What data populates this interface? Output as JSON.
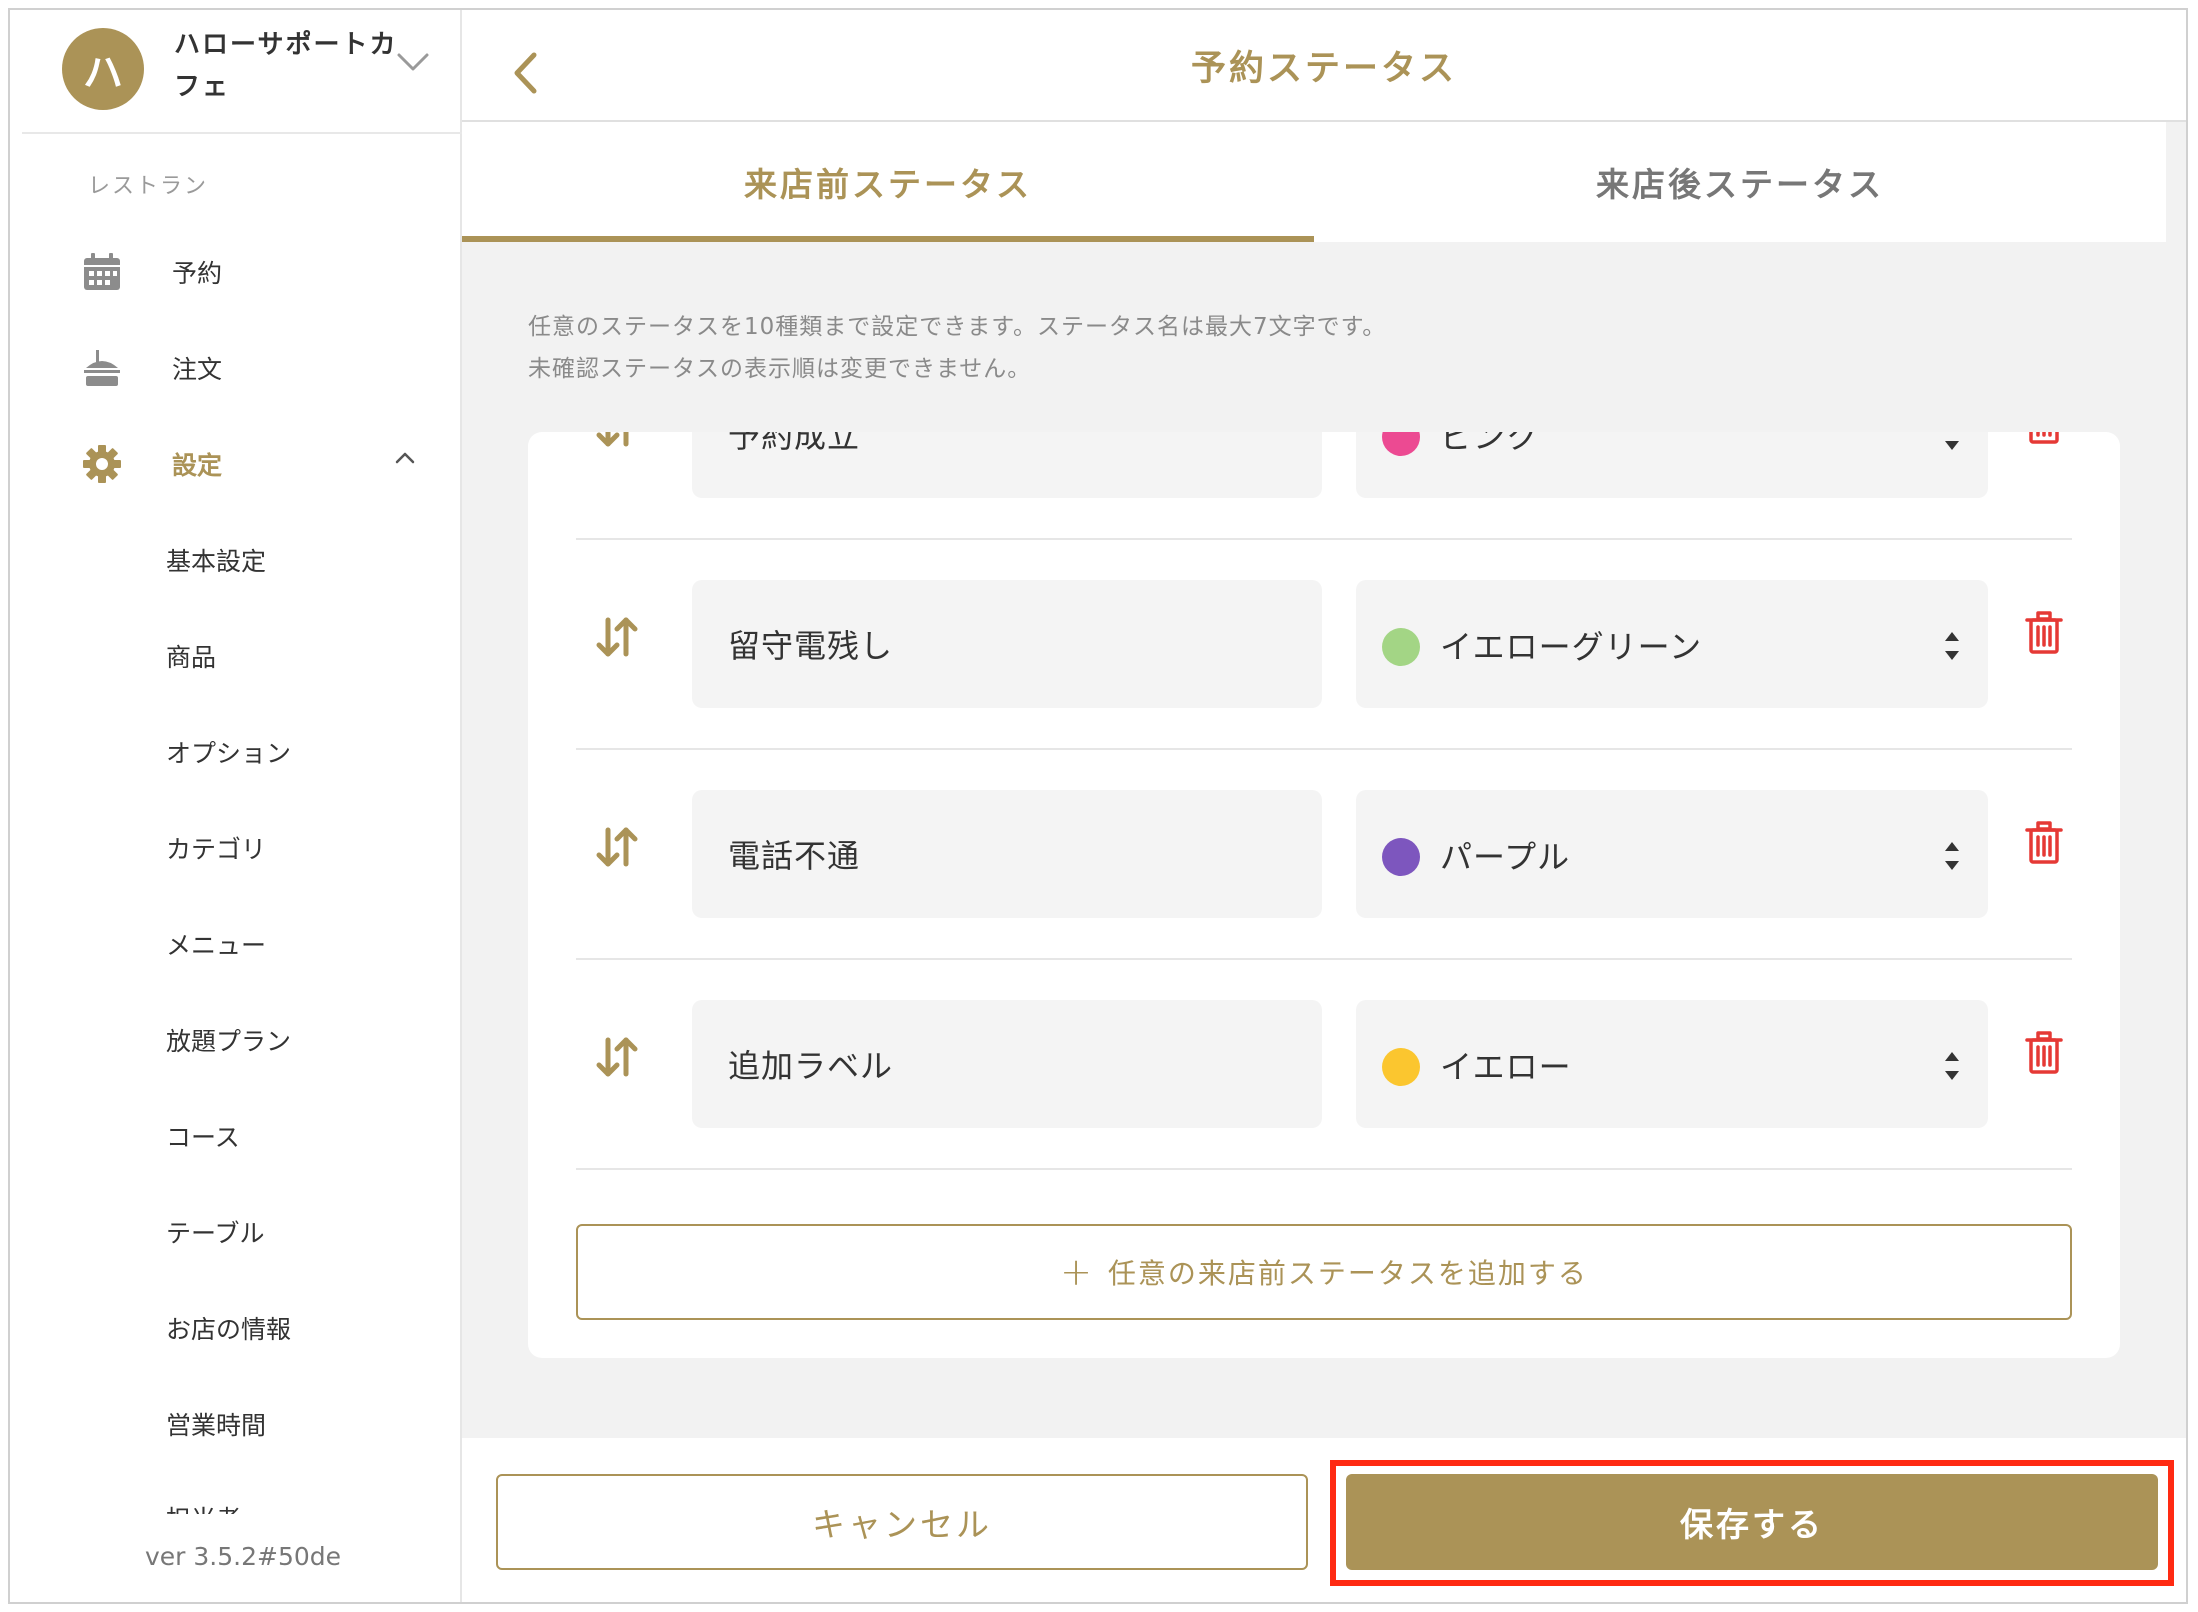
{
  "sidebar": {
    "avatar_initial": "ハ",
    "store_name": "ハローサポートカフェ",
    "section_label": "レストラン",
    "nav": {
      "reservations": "予約",
      "orders": "注文",
      "settings": "設定"
    },
    "settings_items": [
      "基本設定",
      "商品",
      "オプション",
      "カテゴリ",
      "メニュー",
      "放題プラン",
      "コース",
      "テーブル",
      "お店の情報",
      "営業時間"
    ],
    "partial_item": "担当者",
    "version": "ver 3.5.2#50de"
  },
  "header": {
    "title": "予約ステータス"
  },
  "tabs": {
    "before_visit": "来店前ステータス",
    "after_visit": "来店後ステータス"
  },
  "description": {
    "line1": "任意のステータスを10種類まで設定できます。ステータス名は最大7文字です。",
    "line2": "未確認ステータスの表示順は変更できません。"
  },
  "statuses": [
    {
      "name": "予約成立",
      "color_label": "ピンク",
      "color": "#ec4a92"
    },
    {
      "name": "留守電残し",
      "color_label": "イエローグリーン",
      "color": "#a3d585"
    },
    {
      "name": "電話不通",
      "color_label": "パープル",
      "color": "#7d56be"
    },
    {
      "name": "追加ラベル",
      "color_label": "イエロー",
      "color": "#fbc62f"
    }
  ],
  "add_button": {
    "plus": "+",
    "label": "任意の来店前ステータスを追加する"
  },
  "footer": {
    "cancel": "キャンセル",
    "save": "保存する"
  },
  "colors": {
    "accent": "#ab9357",
    "danger": "#e53935",
    "highlight": "#ff2a12"
  }
}
